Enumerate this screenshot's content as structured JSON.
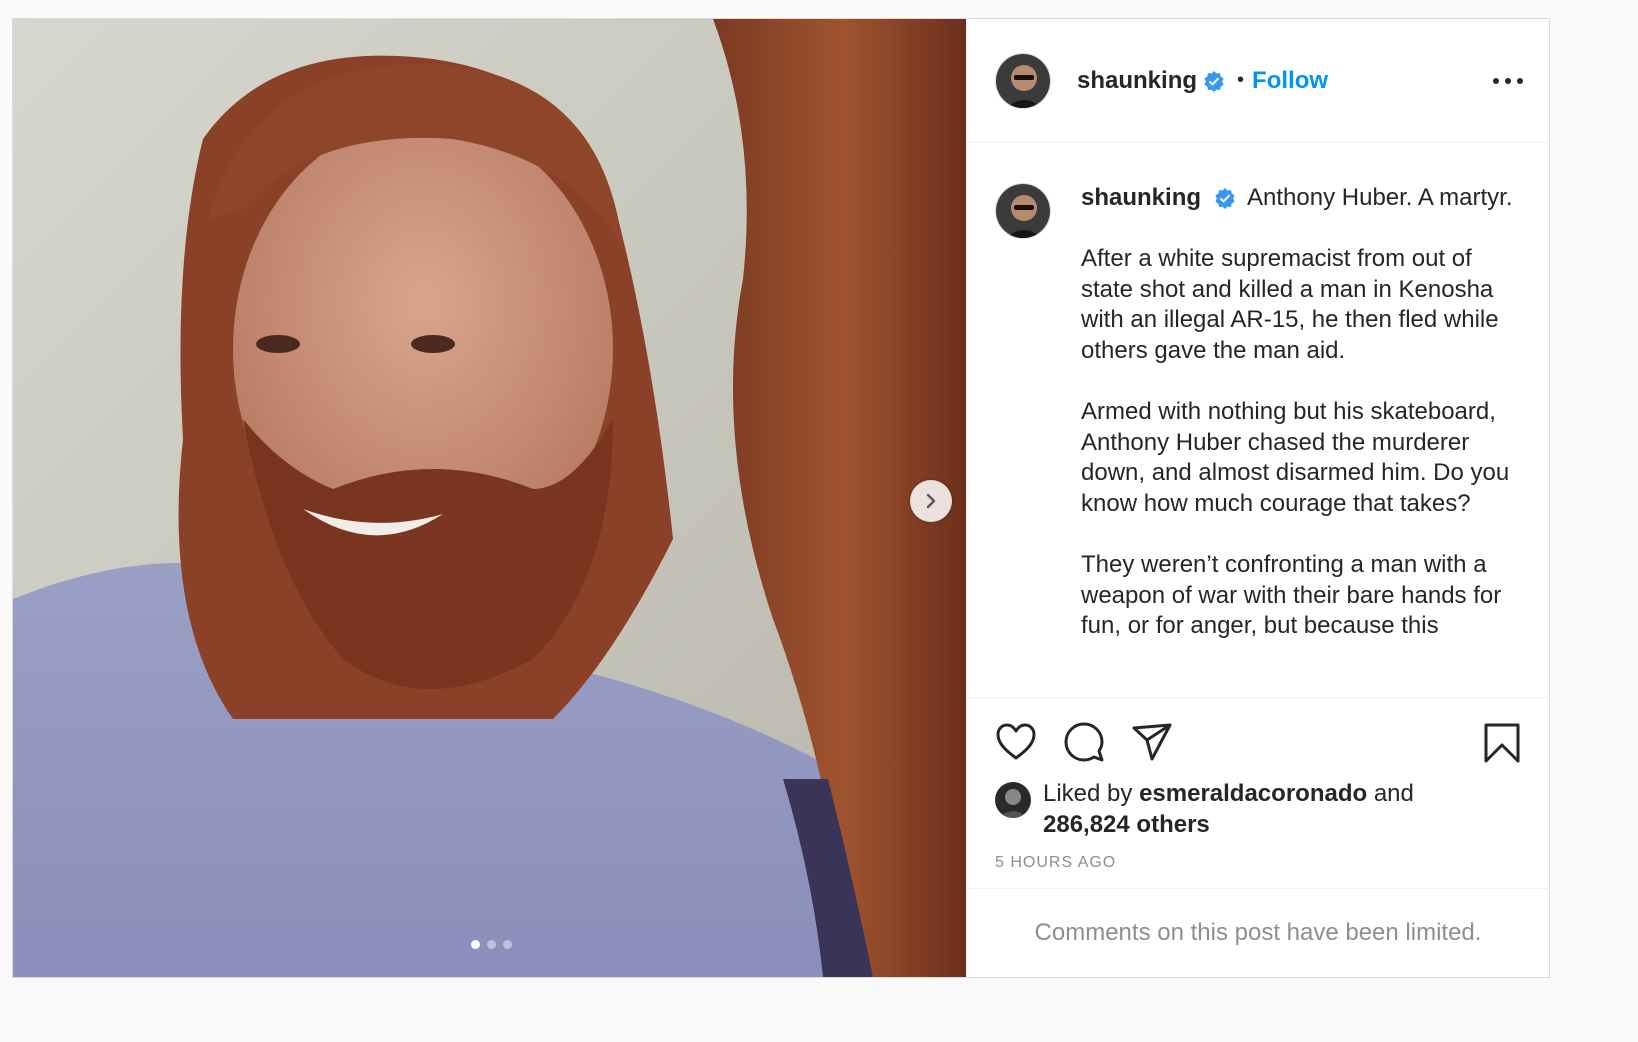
{
  "post": {
    "username": "shaunking",
    "follow_label": "Follow",
    "separator": "•",
    "carousel": {
      "slide_count": 3,
      "active_index": 0
    }
  },
  "caption": {
    "username": "shaunking",
    "first_line": "Anthony Huber. A martyr.",
    "paragraphs": [
      "After a white supremacist from out of state shot and killed a man in Kenosha with an illegal AR-15, he then fled while others gave the man aid.",
      "Armed with nothing but his skateboard, Anthony Huber chased the murderer down, and almost disarmed him. Do you know how much courage that takes?",
      "They weren’t confronting a man with a weapon of war with their bare hands for fun, or for anger, but because this"
    ]
  },
  "likes": {
    "prefix": "Liked by ",
    "user": "esmeraldacoronado",
    "middle": " and",
    "others": "286,824 others"
  },
  "timestamp": "5 HOURS AGO",
  "comments_notice": "Comments on this post have been limited.",
  "colors": {
    "link": "#0095f6",
    "verified": "#3897f0",
    "muted": "#8e8e8e"
  },
  "icons": [
    "chevron-right-icon",
    "verified-badge-icon",
    "more-options-icon",
    "heart-icon",
    "comment-icon",
    "share-icon",
    "bookmark-icon"
  ]
}
